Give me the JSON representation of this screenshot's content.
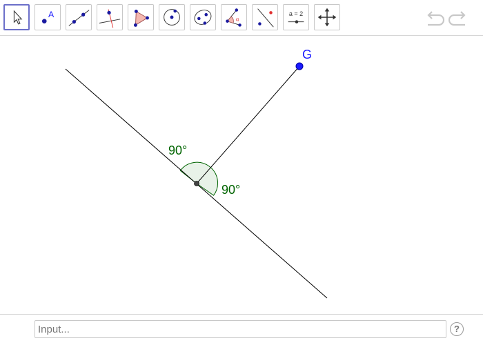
{
  "toolbar": {
    "tools": [
      {
        "name": "move-tool",
        "icon": "pointer-arrow-icon",
        "active": true
      },
      {
        "name": "point-tool",
        "icon": "point-icon",
        "label": "A"
      },
      {
        "name": "line-tool",
        "icon": "line-through-two-points-icon"
      },
      {
        "name": "perpendicular-line-tool",
        "icon": "perpendicular-line-icon"
      },
      {
        "name": "polygon-tool",
        "icon": "polygon-icon"
      },
      {
        "name": "circle-tool",
        "icon": "circle-center-point-icon"
      },
      {
        "name": "conic-tool",
        "icon": "ellipse-icon"
      },
      {
        "name": "angle-tool",
        "icon": "angle-icon",
        "label": "α"
      },
      {
        "name": "reflect-tool",
        "icon": "reflect-about-line-icon"
      },
      {
        "name": "slider-tool",
        "icon": "slider-icon",
        "label": "a = 2"
      },
      {
        "name": "move-graphics-view-tool",
        "icon": "move-graphics-view-icon"
      }
    ],
    "undo_icon": "undo-icon",
    "redo_icon": "redo-icon"
  },
  "canvas": {
    "point_label": "G",
    "angle_label_1": "90°",
    "angle_label_2": "90°",
    "colors": {
      "point": "#1a1aff",
      "label": "#1a1aff",
      "angle": "#006400",
      "angle_fill": "#e8f2e8",
      "line": "#000000"
    }
  },
  "input": {
    "placeholder": "Input..."
  },
  "help": {
    "label": "?"
  }
}
